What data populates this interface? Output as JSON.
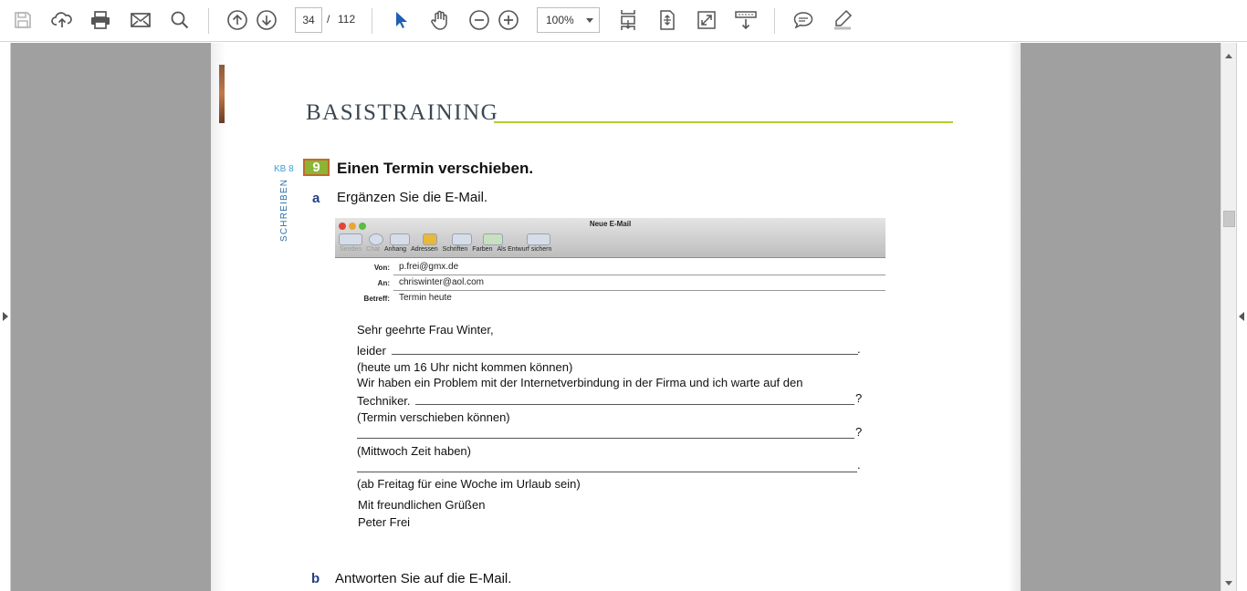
{
  "toolbar": {
    "page_current": "34",
    "page_sep": "/",
    "page_total": "112",
    "zoom": "100%",
    "icons": [
      "save-icon",
      "upload-icon",
      "print-icon",
      "email-icon",
      "search-icon",
      "previous-page-icon",
      "next-page-icon",
      "select-cursor-icon",
      "hand-pan-icon",
      "zoom-out-icon",
      "zoom-in-icon",
      "scroll-mode-icon",
      "fit-page-icon",
      "fullscreen-icon",
      "read-aloud-icon",
      "comment-icon",
      "highlight-icon"
    ]
  },
  "document": {
    "section_title": "BASISTRAINING",
    "exercise_ref": "KB 8",
    "exercise_number": "9",
    "exercise_heading": "Einen Termin verschieben.",
    "side_label": "SCHREIBEN",
    "part_a_label": "a",
    "part_a_heading": "Ergänzen Sie die E-Mail.",
    "part_b_label": "b",
    "part_b_heading": "Antworten Sie auf die E-Mail.",
    "mail_window": {
      "title": "Neue E-Mail",
      "toolbar_labels": [
        "Senden",
        "Chat",
        "Anhang",
        "Adressen",
        "Schriften",
        "Farben",
        "Als Entwurf sichern"
      ],
      "from_label": "Von:",
      "from_value": "p.frei@gmx.de",
      "to_label": "An:",
      "to_value": "chriswinter@aol.com",
      "subject_label": "Betreff:",
      "subject_value": "Termin heute"
    },
    "mail_body": {
      "greeting": "Sehr geehrte Frau Winter,",
      "line1": "leider",
      "line1_end": ".",
      "hint1": "(heute um 16 Uhr nicht kommen können)",
      "sentence2a": "Wir haben ein Problem mit der Internetverbindung in der Firma und ich warte auf den",
      "sentence2b": "Techniker.",
      "sentence2_end": "?",
      "hint2": "(Termin verschieben können)",
      "line3_end": "?",
      "hint3": "(Mittwoch Zeit haben)",
      "line4_end": ".",
      "hint4": "(ab Freitag für eine Woche im Urlaub sein)",
      "closing": "Mit freundlichen Grüßen",
      "signature": "Peter Frei"
    }
  }
}
